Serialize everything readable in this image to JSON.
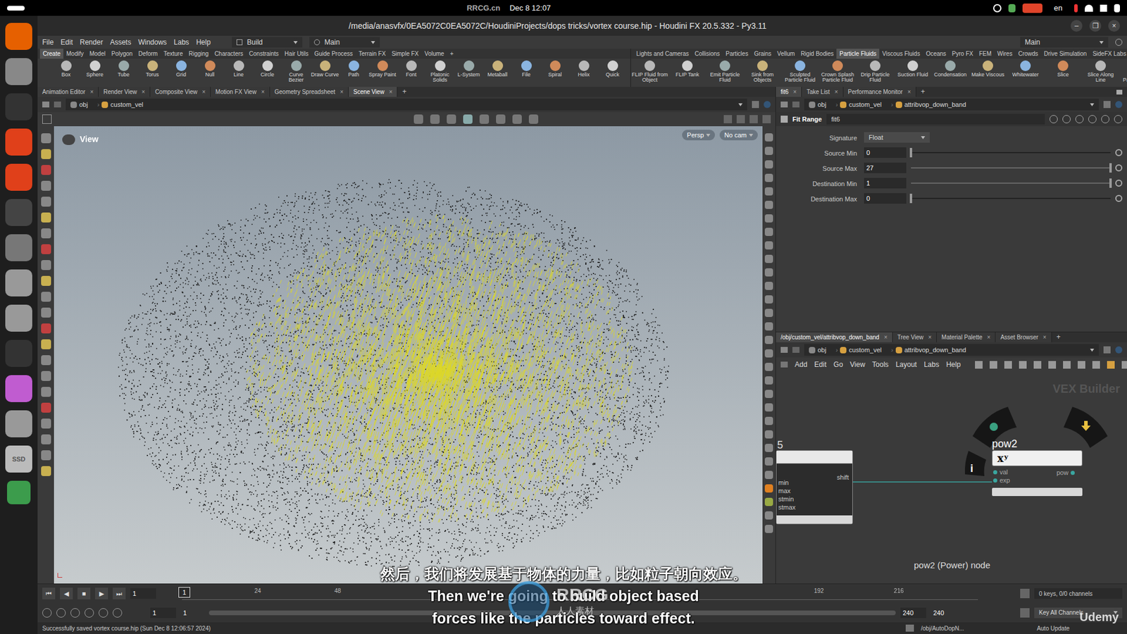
{
  "system_bar": {
    "watermark": "RRCG.cn",
    "clock": "Dec 8  12:07",
    "language": "en"
  },
  "dock": {
    "drive_label": "SSD"
  },
  "window": {
    "title": "/media/anasvfx/0EA5072C0EA5072C/HoudiniProjects/dops tricks/vortex course.hip - Houdini FX 20.5.332 - Py3.11",
    "controls": [
      "–",
      "❐",
      "×"
    ]
  },
  "menu": [
    "File",
    "Edit",
    "Render",
    "Assets",
    "Windows",
    "Labs",
    "Help"
  ],
  "desktop_dropdown": "Build",
  "network_dropdown": "Main",
  "right_dropdown": "Main",
  "shelf_tabs_left": [
    {
      "label": "Create",
      "selected": true
    },
    {
      "label": "Modify",
      "selected": false
    },
    {
      "label": "Model",
      "selected": false
    },
    {
      "label": "Polygon",
      "selected": false
    },
    {
      "label": "Deform",
      "selected": false
    },
    {
      "label": "Texture",
      "selected": false
    },
    {
      "label": "Rigging",
      "selected": false
    },
    {
      "label": "Characters",
      "selected": false
    },
    {
      "label": "Constraints",
      "selected": false
    },
    {
      "label": "Hair Utils",
      "selected": false
    },
    {
      "label": "Guide Process",
      "selected": false
    },
    {
      "label": "Terrain FX",
      "selected": false
    },
    {
      "label": "Simple FX",
      "selected": false
    },
    {
      "label": "Volume",
      "selected": false
    },
    {
      "label": "+",
      "selected": false
    }
  ],
  "shelf_tabs_right": [
    {
      "label": "Lights and Cameras",
      "selected": false
    },
    {
      "label": "Collisions",
      "selected": false
    },
    {
      "label": "Particles",
      "selected": false
    },
    {
      "label": "Grains",
      "selected": false
    },
    {
      "label": "Vellum",
      "selected": false
    },
    {
      "label": "Rigid Bodies",
      "selected": false
    },
    {
      "label": "Particle Fluids",
      "selected": true
    },
    {
      "label": "Viscous Fluids",
      "selected": false
    },
    {
      "label": "Oceans",
      "selected": false
    },
    {
      "label": "Pyro FX",
      "selected": false
    },
    {
      "label": "FEM",
      "selected": false
    },
    {
      "label": "Wires",
      "selected": false
    },
    {
      "label": "Crowds",
      "selected": false
    },
    {
      "label": "Drive Simulation",
      "selected": false
    },
    {
      "label": "SideFX Labs",
      "selected": false
    },
    {
      "label": "+",
      "selected": false
    }
  ],
  "shelf_tools_left": [
    "Box",
    "Sphere",
    "Tube",
    "Torus",
    "Grid",
    "Null",
    "Line",
    "Circle",
    "Curve Bezier",
    "Draw Curve",
    "Path",
    "Spray Paint",
    "Font",
    "Platonic Solids",
    "L-System",
    "Metaball",
    "File",
    "Spiral",
    "Helix",
    "Quick"
  ],
  "shelf_tools_right": [
    "FLIP Fluid from Object",
    "FLIP Tank",
    "Emit Particle Fluid",
    "Sink from Objects",
    "Sculpted Particle Fluid",
    "Crown Splash Particle Fluid",
    "Drip Particle Fluid",
    "Suction Fluid",
    "Condensation",
    "Make Viscous",
    "Whitewater",
    "Slice",
    "Slice Along Line",
    "Distribute Particle Fluid"
  ],
  "close_glyph": "×",
  "scene_tabs": [
    {
      "label": "Animation Editor",
      "selected": false
    },
    {
      "label": "Render View",
      "selected": false
    },
    {
      "label": "Composite View",
      "selected": false
    },
    {
      "label": "Motion FX View",
      "selected": false
    },
    {
      "label": "Geometry Spreadsheet",
      "selected": false
    },
    {
      "label": "Scene View",
      "selected": true
    }
  ],
  "scene_path": [
    "obj",
    "custom_vel"
  ],
  "viewport": {
    "label": "View",
    "projection": "Persp",
    "camera": "No cam"
  },
  "timeline": {
    "buttons": [
      "⏮",
      "◀",
      "■",
      "▶",
      "⏭"
    ],
    "current_frame": "1",
    "ruler_start": "1",
    "ticks": [
      "24",
      "48",
      "192",
      "216"
    ],
    "range_start": "1",
    "range_start2": "1",
    "range_end": "240",
    "range_end2": "240",
    "keys": "0 keys, 0/0 channels",
    "key_all": "Key All Channels"
  },
  "params": {
    "tabs": [
      {
        "label": "fit6",
        "selected": true
      },
      {
        "label": "Take List",
        "selected": false
      },
      {
        "label": "Performance Monitor",
        "selected": false
      }
    ],
    "path": [
      "obj",
      "custom_vel",
      "attribvop_down_band"
    ],
    "node_type": "Fit Range",
    "node_name": "fit6",
    "rows": [
      {
        "label": "Signature",
        "kind": "menu",
        "value": "Float"
      },
      {
        "label": "Source Min",
        "kind": "slider",
        "value": "0",
        "level": 0
      },
      {
        "label": "Source Max",
        "kind": "slider",
        "value": "27",
        "level": 1
      },
      {
        "label": "Destination Min",
        "kind": "slider",
        "value": "1",
        "level": 1
      },
      {
        "label": "Destination Max",
        "kind": "slider",
        "value": "0",
        "level": 0
      }
    ]
  },
  "network": {
    "tabs": [
      {
        "label": "/obj/custom_vel/attribvop_down_band",
        "selected": true
      },
      {
        "label": "Tree View",
        "selected": false
      },
      {
        "label": "Material Palette",
        "selected": false
      },
      {
        "label": "Asset Browser",
        "selected": false
      }
    ],
    "path": [
      "obj",
      "custom_vel",
      "attribvop_down_band"
    ],
    "menu": [
      "Add",
      "Edit",
      "Go",
      "View",
      "Tools",
      "Layout",
      "Labs",
      "Help"
    ],
    "context": "VEX Builder",
    "left_node": {
      "name": "5",
      "output": "shift",
      "inputs": [
        "min",
        "max",
        "stmin",
        "stmax"
      ]
    },
    "pow_node": {
      "name": "pow2",
      "symbol": "xʸ",
      "inputs": [
        "val",
        "exp"
      ],
      "output": "pow"
    },
    "ring_info": "i",
    "info": "pow2 (Power) node"
  },
  "status": {
    "message": "Successfully saved vortex course.hip (Sun Dec 8 12:06:57 2024)",
    "dop_path": "/obj/AutoDopN...",
    "auto_update": "Auto Update"
  },
  "subtitles": {
    "zh": "然后，我们将发展基于物体的力量，比如粒子朝向效应。",
    "en1": "Then we're going to build object based",
    "en2": "forces like the particles toward effect."
  },
  "logo": {
    "brand": "RRCG",
    "sub": "人人素材"
  },
  "udemy": "Udemy"
}
